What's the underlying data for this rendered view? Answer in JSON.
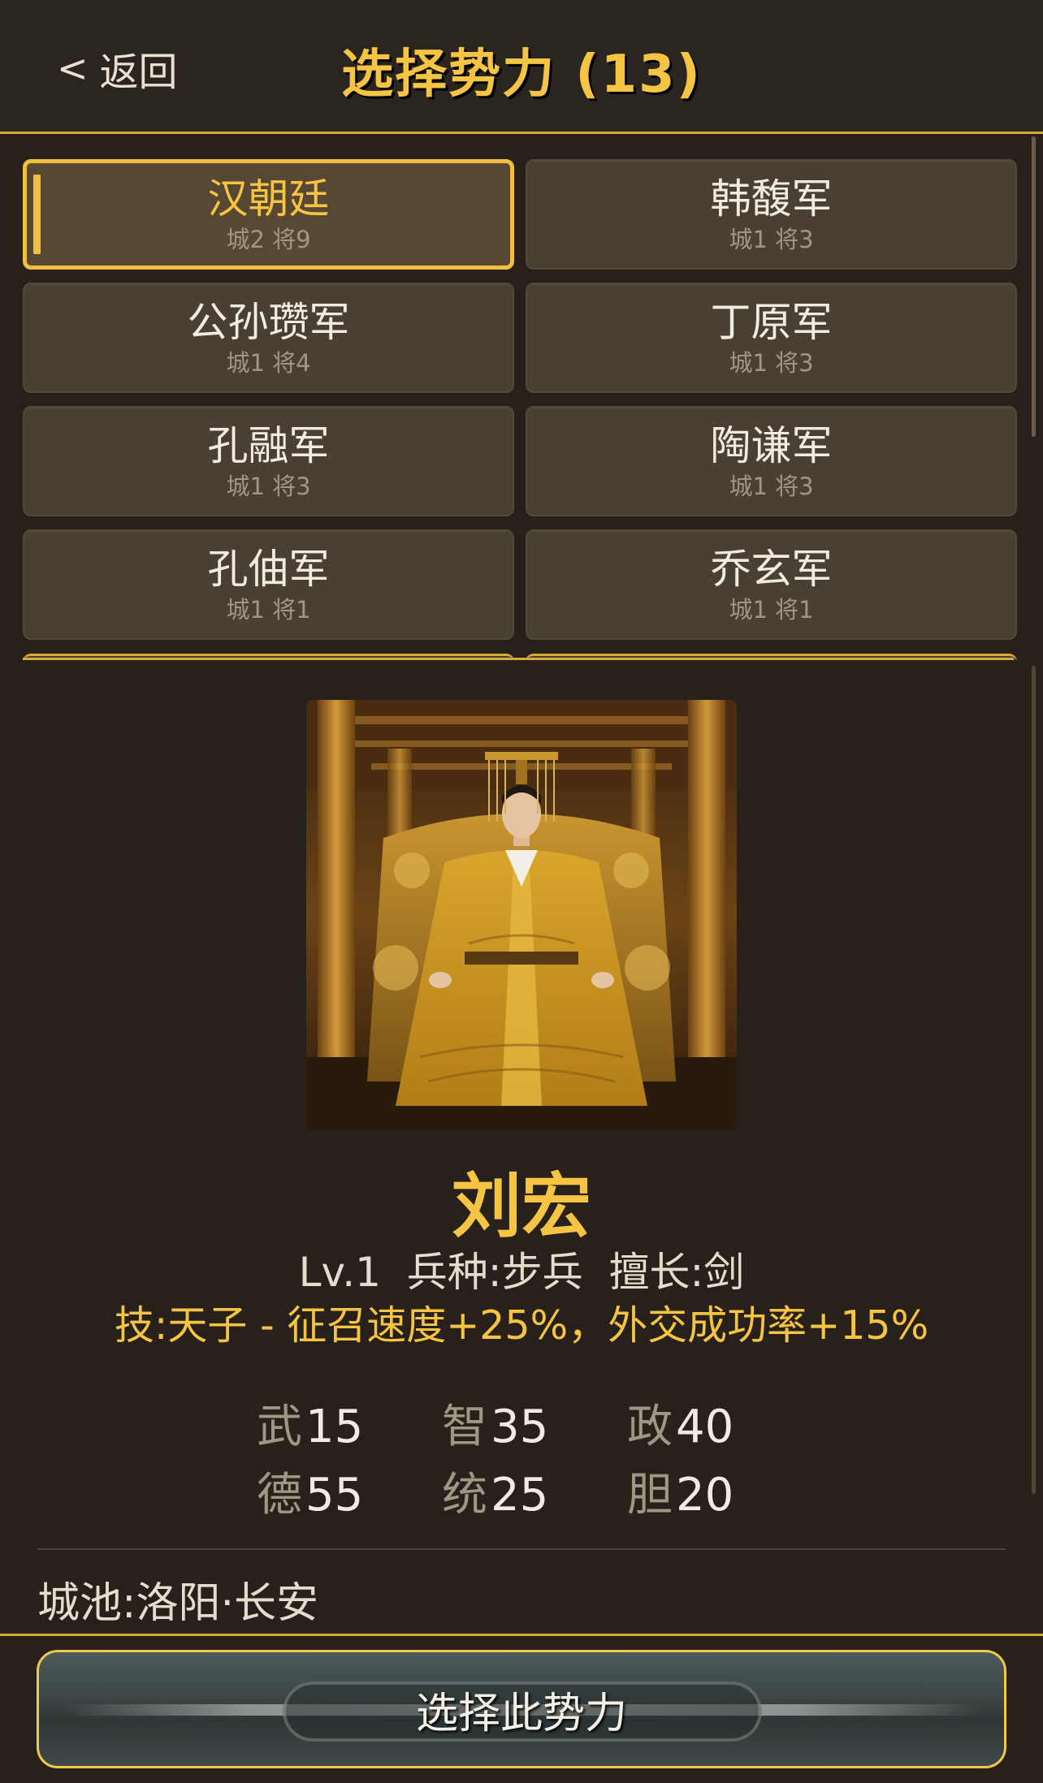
{
  "header": {
    "back_label": "返回",
    "title": "选择势力 (13)"
  },
  "factions": [
    {
      "name": "汉朝廷",
      "stats": "城2 将9",
      "selected": true
    },
    {
      "name": "韩馥军",
      "stats": "城1 将3",
      "selected": false
    },
    {
      "name": "公孙瓒军",
      "stats": "城1 将4",
      "selected": false
    },
    {
      "name": "丁原军",
      "stats": "城1 将3",
      "selected": false
    },
    {
      "name": "孔融军",
      "stats": "城1 将3",
      "selected": false
    },
    {
      "name": "陶谦军",
      "stats": "城1 将3",
      "selected": false
    },
    {
      "name": "孔伷军",
      "stats": "城1 将1",
      "selected": false
    },
    {
      "name": "乔玄军",
      "stats": "城1 将1",
      "selected": false
    }
  ],
  "leader": {
    "portrait_icon": "emperor-on-throne-portrait",
    "name": "刘宏",
    "info": "Lv.1 兵种:步兵 擅长:剑",
    "skill": "技:天子 - 征召速度+25%，外交成功率+15%",
    "stats": [
      {
        "label": "武",
        "value": "15"
      },
      {
        "label": "智",
        "value": "35"
      },
      {
        "label": "政",
        "value": "40"
      },
      {
        "label": "德",
        "value": "55"
      },
      {
        "label": "统",
        "value": "25"
      },
      {
        "label": "胆",
        "value": "20"
      }
    ],
    "cities": "城池:洛阳·长安"
  },
  "footer": {
    "confirm_label": "选择此势力"
  },
  "colors": {
    "background": "#28211b",
    "accent_gold": "#f5c442",
    "card": "#4a3f33",
    "text": "#f2ebe1",
    "muted": "#a19584"
  }
}
